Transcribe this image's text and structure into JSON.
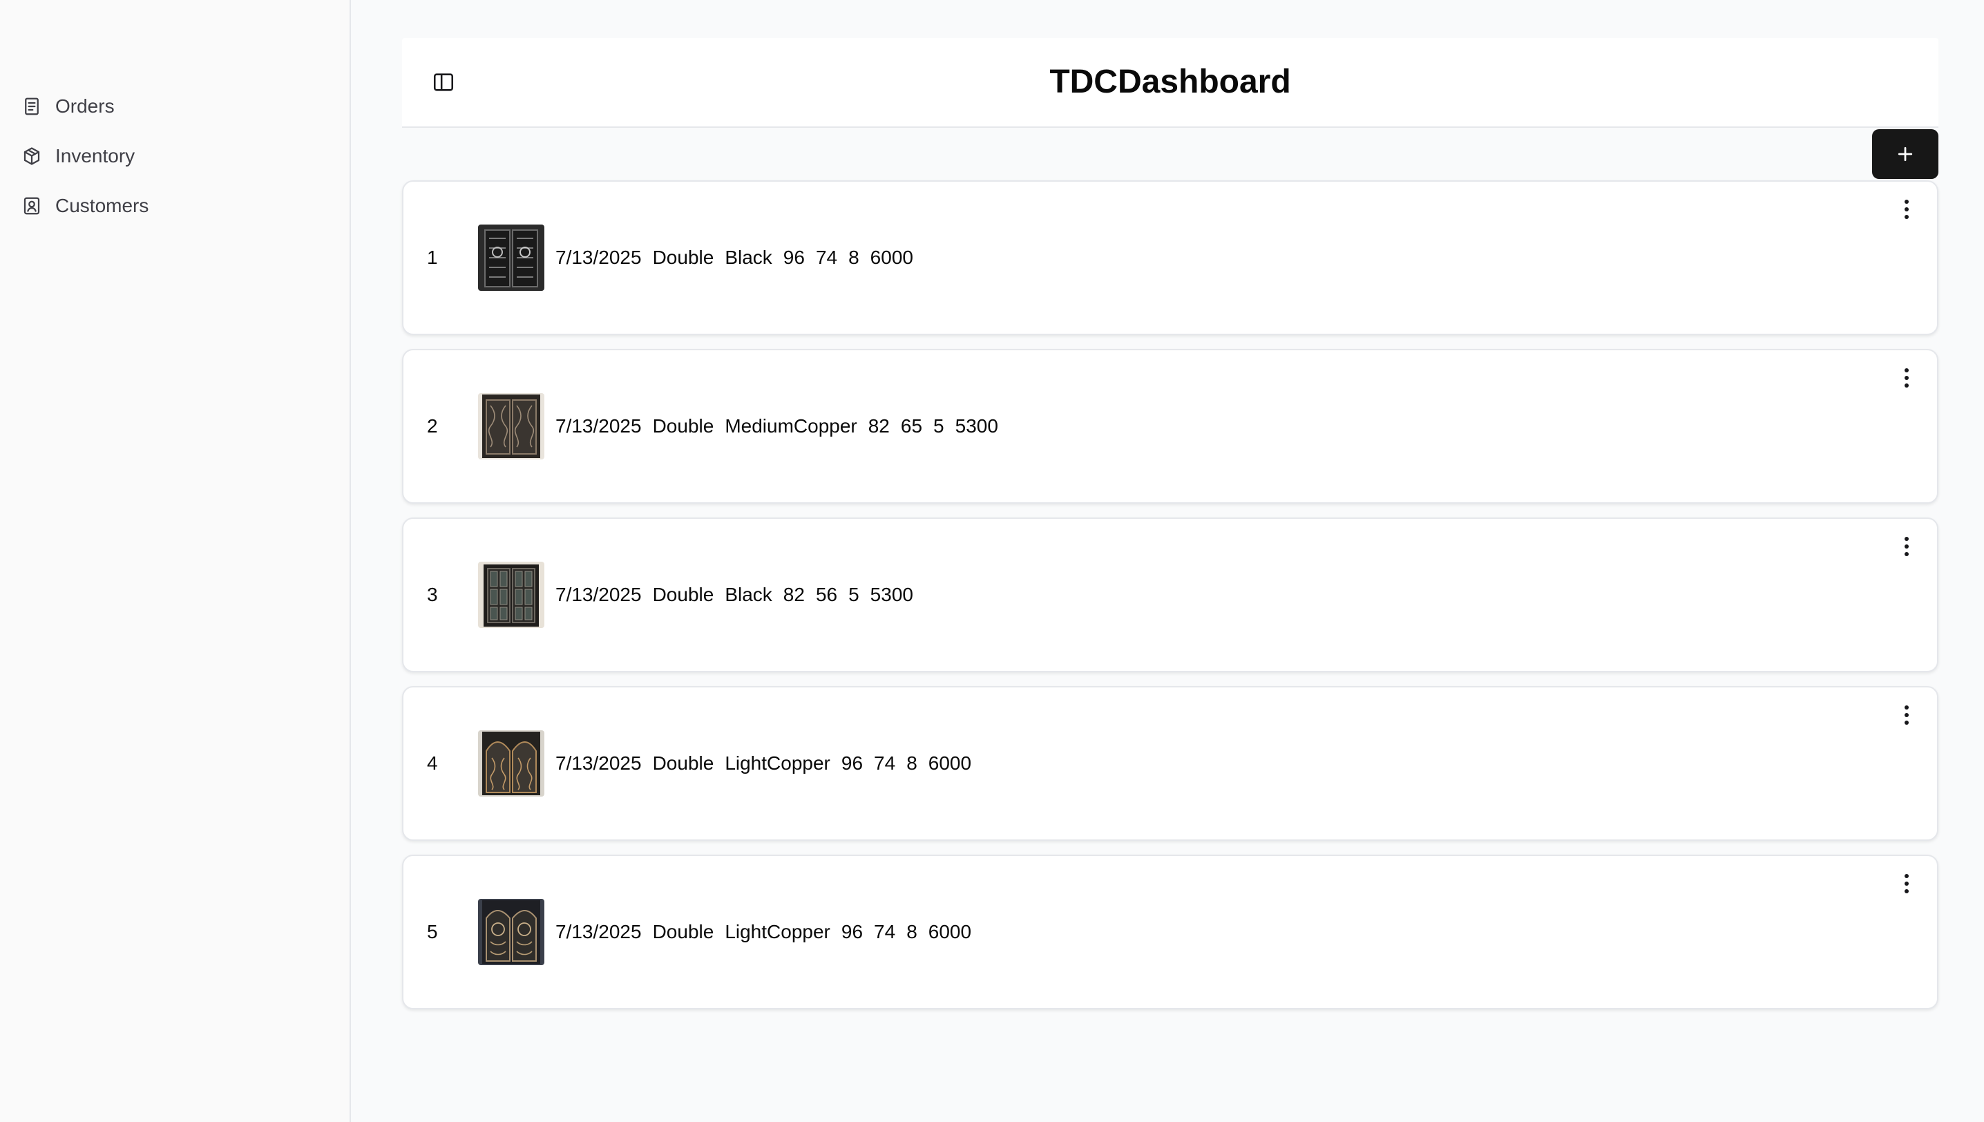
{
  "sidebar": {
    "items": [
      {
        "label": "Orders",
        "icon": "document-icon"
      },
      {
        "label": "Inventory",
        "icon": "box-icon"
      },
      {
        "label": "Customers",
        "icon": "contact-card-icon"
      }
    ]
  },
  "header": {
    "title": "TDCDashboard",
    "toggle_icon": "sidebar-toggle-icon"
  },
  "toolbar": {
    "add_icon": "plus-icon"
  },
  "orders": [
    {
      "index": "1",
      "date": "7/13/2025",
      "type": "Double",
      "color": "Black",
      "height": "96",
      "width": "74",
      "qty": "8",
      "price": "6000"
    },
    {
      "index": "2",
      "date": "7/13/2025",
      "type": "Double",
      "color": "MediumCopper",
      "height": "82",
      "width": "65",
      "qty": "5",
      "price": "5300"
    },
    {
      "index": "3",
      "date": "7/13/2025",
      "type": "Double",
      "color": "Black",
      "height": "82",
      "width": "56",
      "qty": "5",
      "price": "5300"
    },
    {
      "index": "4",
      "date": "7/13/2025",
      "type": "Double",
      "color": "LightCopper",
      "height": "96",
      "width": "74",
      "qty": "8",
      "price": "6000"
    },
    {
      "index": "5",
      "date": "7/13/2025",
      "type": "Double",
      "color": "LightCopper",
      "height": "96",
      "width": "74",
      "qty": "8",
      "price": "6000"
    }
  ],
  "colors": {
    "accent_button": "#171717",
    "background": "#f9fafb",
    "card": "#ffffff",
    "border": "#e5e7eb"
  }
}
